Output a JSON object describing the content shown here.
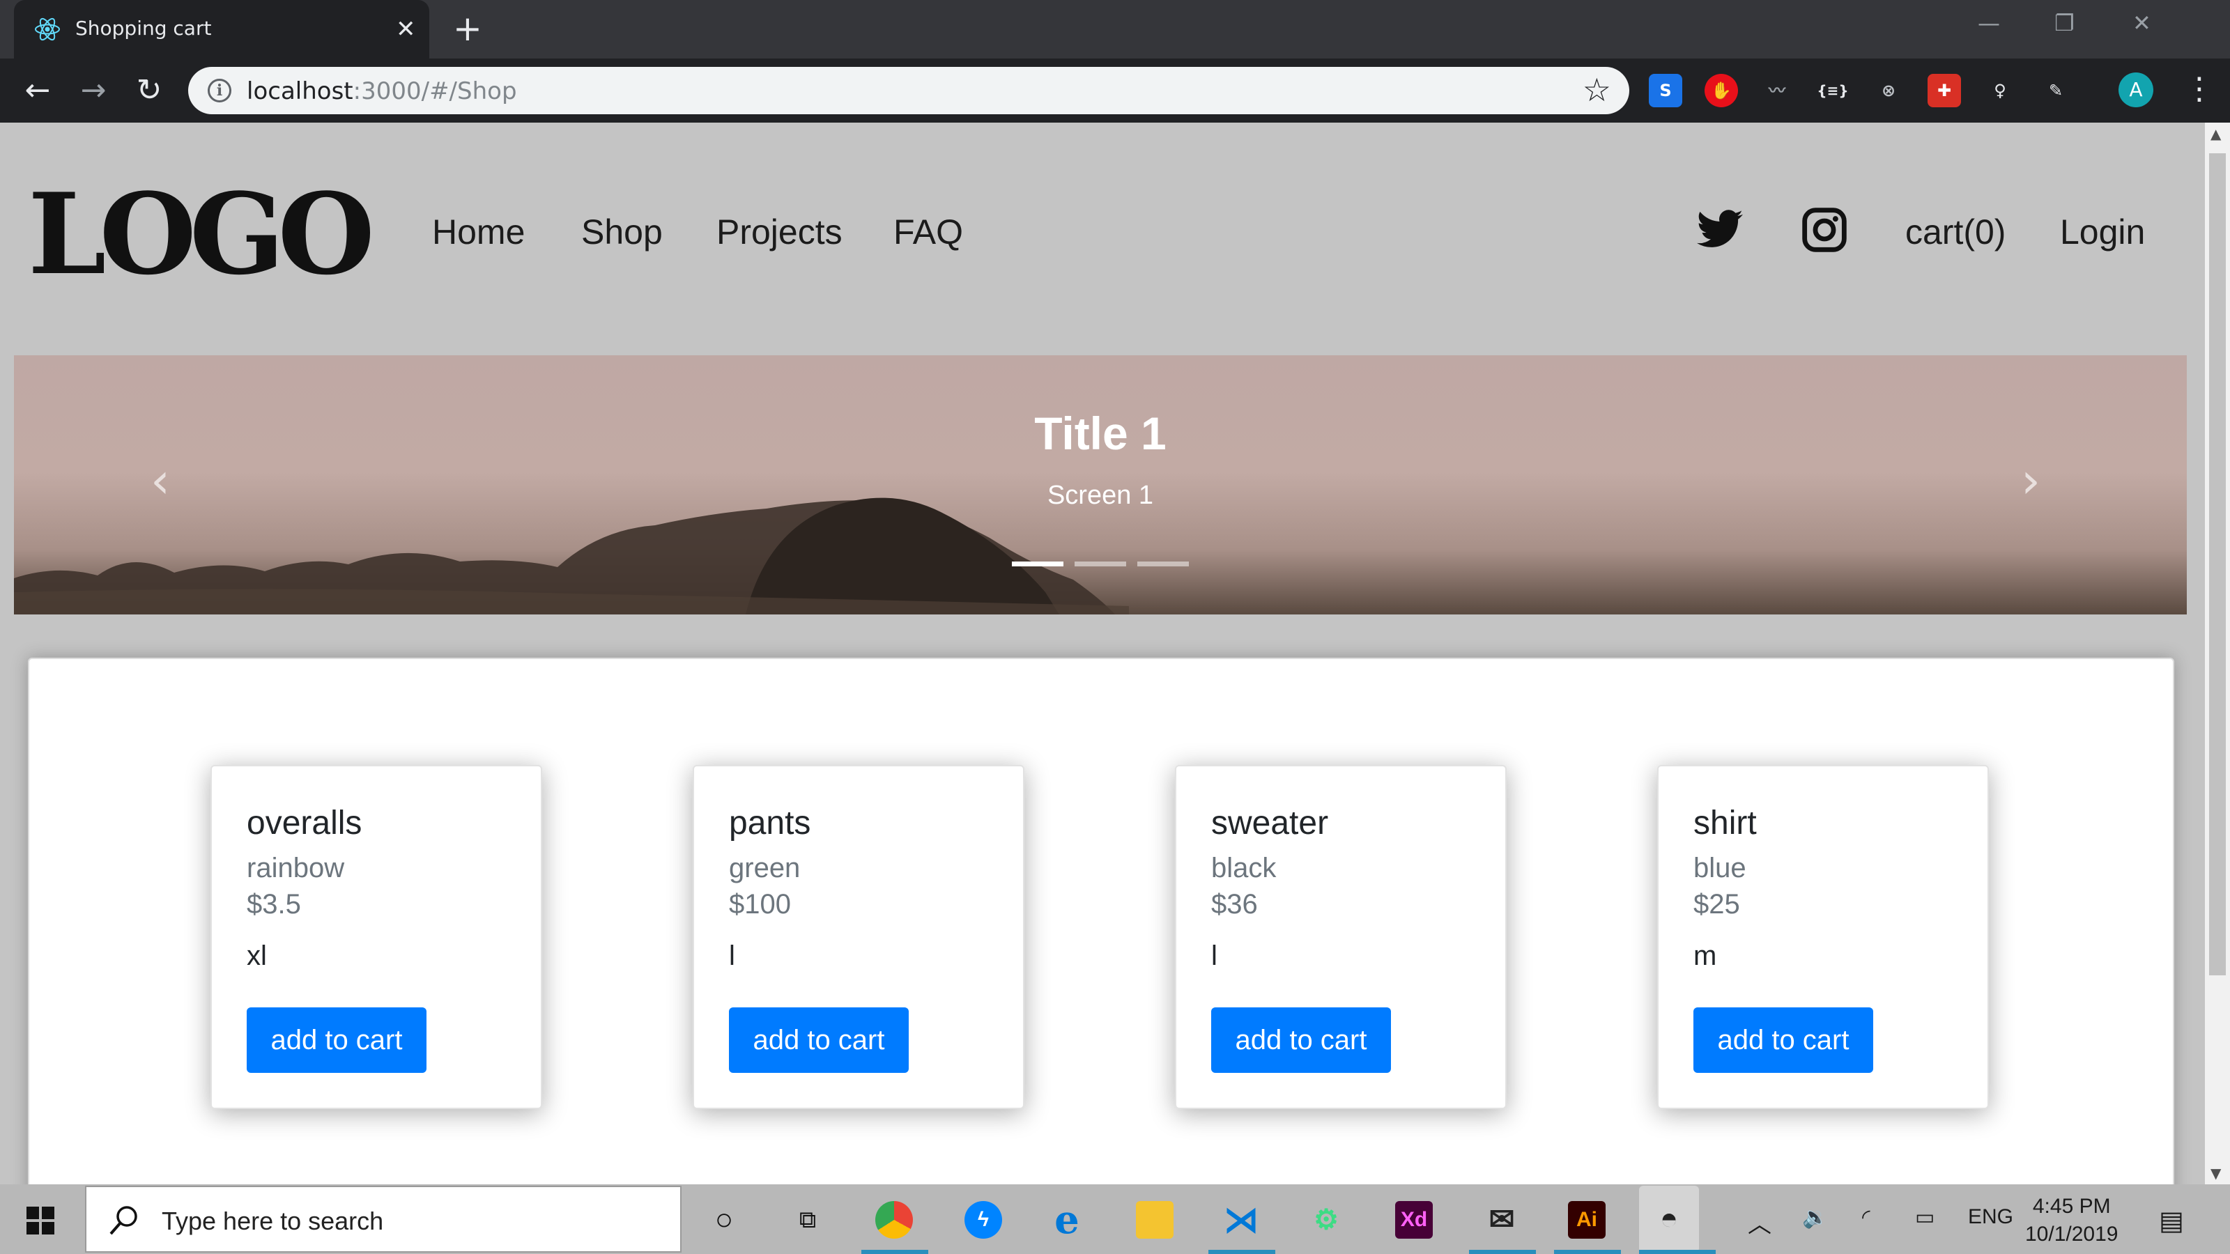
{
  "browser": {
    "tab_title": "Shopping cart",
    "tab_close": "✕",
    "new_tab": "+",
    "url_host": "localhost",
    "url_rest": ":3000/#/Shop"
  },
  "site": {
    "logo": "LOGO",
    "nav": [
      "Home",
      "Shop",
      "Projects",
      "FAQ"
    ],
    "cart": "cart(0)",
    "login": "Login",
    "social_icons": [
      "twitter-icon",
      "instagram-icon"
    ]
  },
  "carousel": {
    "title": "Title 1",
    "subtitle": "Screen 1",
    "active_index": 0,
    "slide_count": 3
  },
  "products": [
    {
      "name": "overalls",
      "color": "rainbow",
      "price": "$3.5",
      "size": "xl",
      "button": "add to cart"
    },
    {
      "name": "pants",
      "color": "green",
      "price": "$100",
      "size": "l",
      "button": "add to cart"
    },
    {
      "name": "sweater",
      "color": "black",
      "price": "$36",
      "size": "l",
      "button": "add to cart"
    },
    {
      "name": "shirt",
      "color": "blue",
      "price": "$25",
      "size": "m",
      "button": "add to cart"
    }
  ],
  "taskbar": {
    "search_placeholder": "Type here to search",
    "language": "ENG",
    "time": "4:45 PM",
    "date": "10/1/2019"
  },
  "colors": {
    "primary_button": "#007bff",
    "page_background": "#c4c4c4",
    "chrome_dark": "#202124"
  }
}
